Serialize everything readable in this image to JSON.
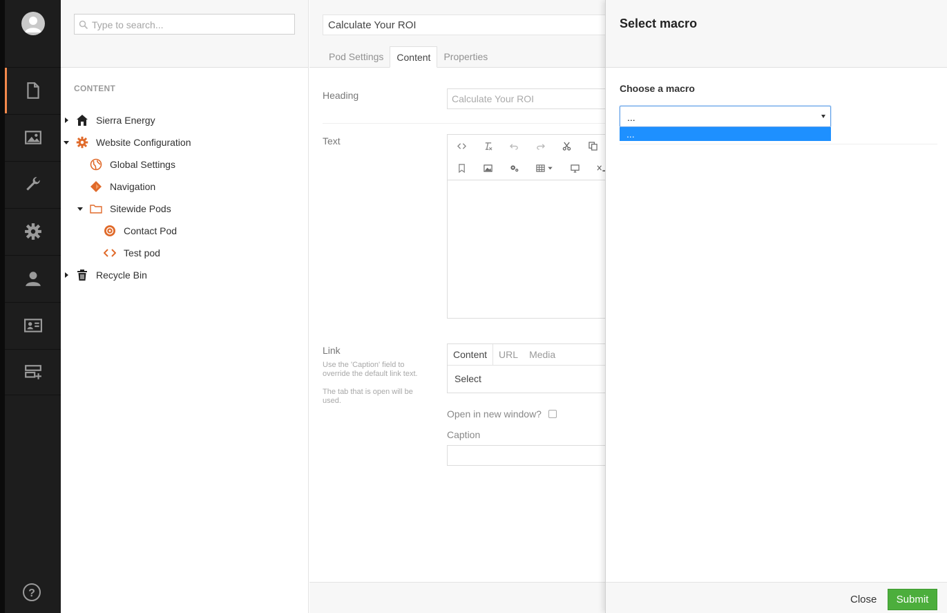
{
  "colors": {
    "accent": "#f5894c",
    "tree_icon": "#e06a2a",
    "submit": "#4cae3c",
    "selected_option": "#1e90ff"
  },
  "search": {
    "placeholder": "Type to search..."
  },
  "rail": {
    "items": [
      {
        "name": "content-section",
        "icon": "document-icon",
        "active": true
      },
      {
        "name": "media-section",
        "icon": "image-icon"
      },
      {
        "name": "developer-section",
        "icon": "wrench-icon"
      },
      {
        "name": "settings-section",
        "icon": "gear-icon"
      },
      {
        "name": "users-section",
        "icon": "user-icon"
      },
      {
        "name": "members-section",
        "icon": "id-card-icon"
      },
      {
        "name": "forms-section",
        "icon": "forms-add-icon"
      }
    ],
    "help_icon": "help-icon"
  },
  "tree": {
    "section_title": "CONTENT",
    "items": [
      {
        "label": "Sierra Energy",
        "icon": "home-icon"
      },
      {
        "label": "Website Configuration",
        "icon": "gear-icon"
      },
      {
        "label": "Global Settings",
        "icon": "globe-icon"
      },
      {
        "label": "Navigation",
        "icon": "diamond-icon"
      },
      {
        "label": "Sitewide Pods",
        "icon": "folder-icon"
      },
      {
        "label": "Contact Pod",
        "icon": "target-icon"
      },
      {
        "label": "Test pod",
        "icon": "code-icon"
      },
      {
        "label": "Recycle Bin",
        "icon": "trash-icon"
      }
    ]
  },
  "editor": {
    "name_value": "Calculate Your ROI",
    "tabs": [
      "Pod Settings",
      "Content",
      "Properties"
    ],
    "active_tab": "Content",
    "heading_label": "Heading",
    "heading_value": "Calculate Your ROI",
    "text_label": "Text",
    "link_label": "Link",
    "link_desc_1": "Use the 'Caption' field to override the default link text.",
    "link_desc_2": "The tab that is open will be used.",
    "link_tabs": [
      "Content",
      "URL",
      "Media"
    ],
    "link_select": "Select",
    "new_window_label": "Open in new window?",
    "caption_label": "Caption"
  },
  "dialog": {
    "title": "Select macro",
    "choose_label": "Choose a macro",
    "select_value": "...",
    "options": [
      "..."
    ],
    "close_label": "Close",
    "submit_label": "Submit"
  }
}
